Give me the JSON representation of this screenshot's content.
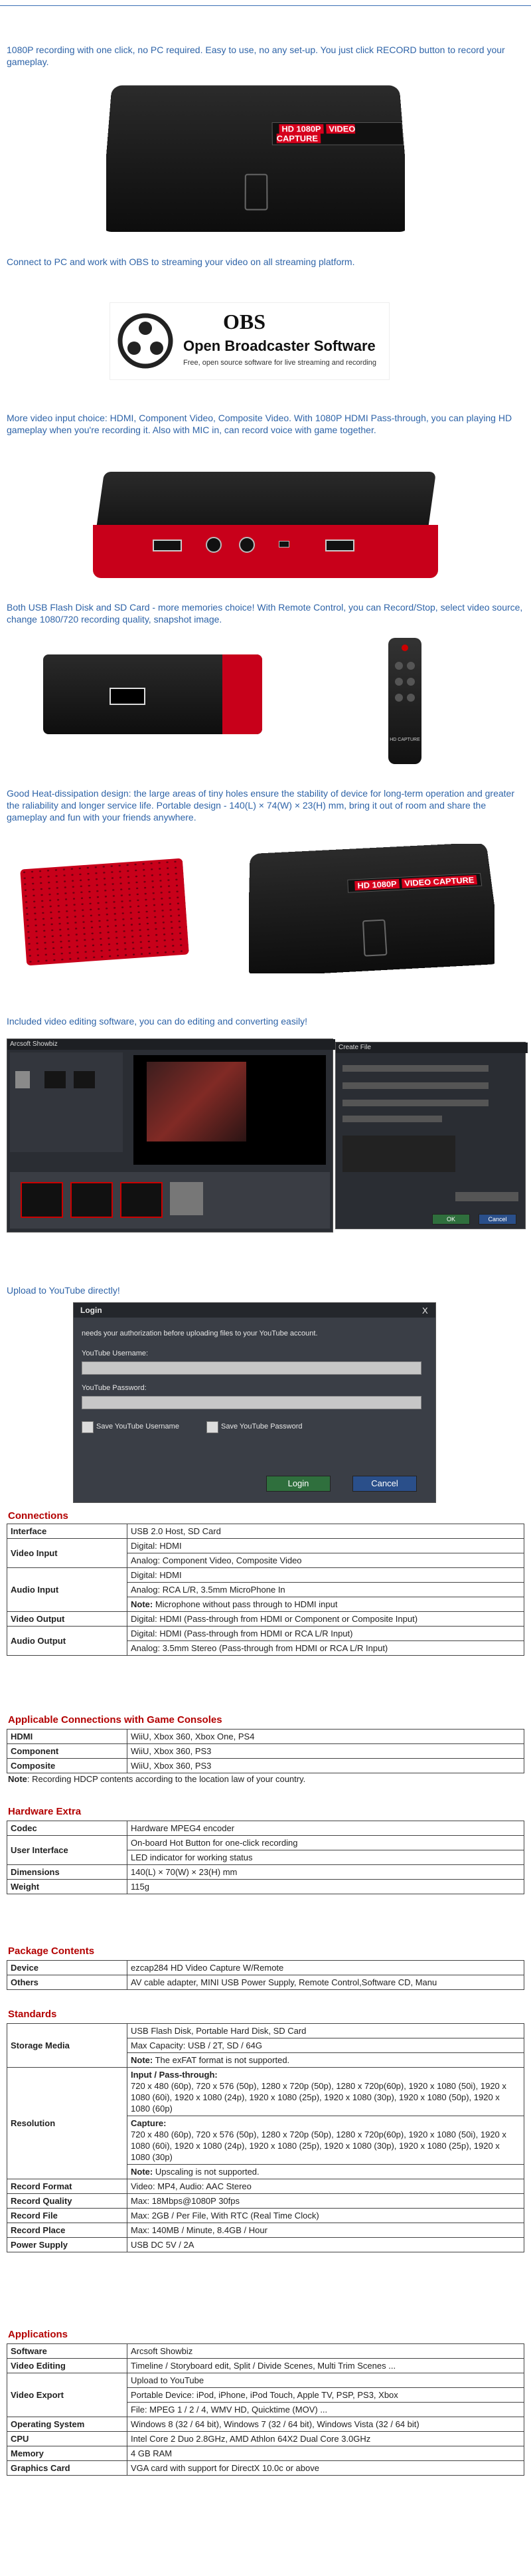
{
  "blurbs": {
    "b1": "1080P recording with one click, no PC required. Easy to use, no any set-up. You just click RECORD button to record your gameplay.",
    "b2": "Connect to PC and work with OBS to streaming your video on all streaming platform.",
    "b3": "More video input choice: HDMI, Component Video, Composite Video. With 1080P HDMI Pass-through, you can playing HD gameplay when you're recording it. Also with MIC in, can record voice with game together.",
    "b4": "Both USB Flash Disk and SD Card - more memories choice! With Remote Control, you can Record/Stop, select video source, change 1080/720 recording quality, snapshot image.",
    "b5": "Good Heat-dissipation design: the large areas of tiny holes ensure the stability of device for long-term operation and greater the raliability and longer service life. Portable design - 140(L) × 74(W) × 23(H) mm, bring it out of room and share the gameplay and fun with your friends anywhere.",
    "b6": "Included video editing software, you can do editing and converting easily!",
    "b7": "Upload to YouTube directly!"
  },
  "device": {
    "badge_left": "HD 1080P",
    "badge_right": "VIDEO CAPTURE",
    "remote_label": "HD CAPTURE"
  },
  "obs": {
    "title": "OBS",
    "name": "Open Broadcaster Software",
    "tagline": "Free, open source software for live streaming and recording"
  },
  "editor": {
    "window_title": "Arcsoft Showbiz",
    "dialog_title": "Create File",
    "ok": "OK",
    "cancel": "Cancel"
  },
  "login": {
    "title": "Login",
    "close": "X",
    "message": "needs your authorization before uploading files to your YouTube account.",
    "username_label": "YouTube Username:",
    "password_label": "YouTube Password:",
    "save_username": "Save YouTube Username",
    "save_password": "Save YouTube Password",
    "login_button": "Login",
    "cancel_button": "Cancel"
  },
  "connections": {
    "title": "Connections",
    "rows": [
      [
        "Interface",
        "USB 2.0 Host, SD Card"
      ],
      [
        "Video Input",
        "Digital: HDMI",
        "Analog: Component Video, Composite Video"
      ],
      [
        "Audio Input",
        "Digital: HDMI",
        "Analog: RCA L/R, 3.5mm MicroPhone In",
        "Note: Microphone without pass through to HDMI input"
      ],
      [
        "Video Output",
        "Digital: HDMI (Pass-through from HDMI or Component or Composite Input)"
      ],
      [
        "Audio Output",
        "Digital: HDMI (Pass-through from HDMI or RCA L/R Input)",
        "Analog: 3.5mm Stereo (Pass-through from HDMI or RCA L/R Input)"
      ]
    ],
    "note_bold": "Note:",
    "audio_note_text": "Microphone without pass through to HDMI input"
  },
  "consoles": {
    "title": "Applicable Connections with Game Consoles",
    "rows": [
      [
        "HDMI",
        "WiiU, Xbox 360, Xbox One, PS4"
      ],
      [
        "Component",
        "WiiU, Xbox 360, PS3"
      ],
      [
        "Composite",
        "WiiU, Xbox 360, PS3"
      ]
    ],
    "note_bold": "Note",
    "note_text": ": Recording HDCP contents according to  the location law of your country."
  },
  "hardware": {
    "title": "Hardware Extra",
    "codec_k": "Codec",
    "codec_v": "Hardware MPEG4 encoder",
    "ui_k": "User Interface",
    "ui_v1": "On-board Hot Button for one-click recording",
    "ui_v2": "LED indicator for working status",
    "dim_k": "Dimensions",
    "dim_v": "140(L) × 70(W) × 23(H) mm",
    "weight_k": "Weight",
    "weight_v": "115g"
  },
  "package": {
    "title": "Package Contents",
    "device_k": "Device",
    "device_v": "ezcap284 HD Video Capture W/Remote",
    "others_k": "Others",
    "others_v": "AV cable adapter, MINI USB Power Supply, Remote Control,Software CD, Manu"
  },
  "standards": {
    "title": "Standards",
    "storage_k": "Storage Media",
    "storage_v1": "USB Flash Disk, Portable Hard Disk, SD Card",
    "storage_v2": "Max Capacity: USB / 2T, SD / 64G",
    "storage_note_bold": "Note:",
    "storage_note_text": " The exFAT format is not supported.",
    "res_k": "Resolution",
    "pass_title": "Input / Pass-through:",
    "pass_text": "720 x 480 (60p), 720 x 576 (50p), 1280 x 720p (50p), 1280 x 720p(60p), 1920 x 1080 (50i), 1920 x 1080 (60i), 1920 x 1080 (24p), 1920 x 1080 (25p), 1920 x 1080 (30p), 1920 x 1080 (50p), 1920 x 1080 (60p)",
    "cap_title": "Capture:",
    "cap_text": "720 x 480 (60p), 720 x 576 (50p), 1280 x 720p (50p), 1280 x 720p(60p), 1920 x 1080 (50i), 1920 x 1080 (60i), 1920 x 1080 (24p), 1920 x 1080 (25p), 1920 x 1080 (30p), 1920 x 1080 (25p), 1920 x 1080 (30p)",
    "res_note_bold": "Note:",
    "res_note_text": " Upscaling is not supported.",
    "rf_k": "Record Format",
    "rf_v": "Video: MP4, Audio: AAC Stereo",
    "rq_k": "Record Quality",
    "rq_v": "Max: 18Mbps@1080P 30fps",
    "rfile_k": "Record File",
    "rfile_v": "Max: 2GB / Per File, With RTC (Real Time Clock)",
    "rp_k": "Record Place",
    "rp_v": "Max: 140MB / Minute, 8.4GB / Hour",
    "ps_k": "Power Supply",
    "ps_v": "USB DC 5V / 2A"
  },
  "applications": {
    "title": "Applications",
    "sw_k": "Software",
    "sw_v": "Arcsoft Showbiz",
    "ve_k": "Video Editing",
    "ve_v": "Timeline / Storyboard edit, Split / Divide Scenes, Multi Trim Scenes ...",
    "vx_k": "Video Export",
    "vx_v1": "Upload to YouTube",
    "vx_v2": "Portable Device: iPod, iPhone, iPod Touch, Apple TV, PSP, PS3, Xbox",
    "vx_v3": "File: MPEG 1 / 2 / 4, WMV HD, Quicktime (MOV) ...",
    "os_k": "Operating System",
    "os_v": "Windows 8 (32 / 64 bit), Windows 7 (32 / 64 bit), Windows Vista (32 / 64 bit)",
    "cpu_k": "CPU",
    "cpu_v": "Intel Core 2 Duo 2.8GHz, AMD Athlon 64X2 Dual Core 3.0GHz",
    "mem_k": "Memory",
    "mem_v": "4 GB RAM",
    "gc_k": "Graphics Card",
    "gc_v": "VGA card with support for DirectX 10.0c or above"
  },
  "colors": {
    "accent_blue": "#2f64a8",
    "section_red": "#b30000",
    "device_red": "#d6001c"
  }
}
